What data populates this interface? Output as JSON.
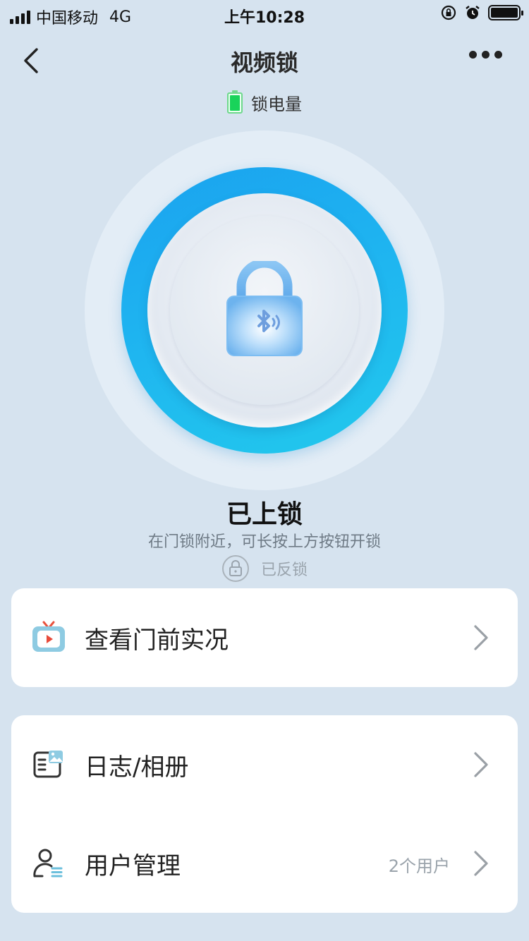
{
  "status_bar": {
    "carrier": "中国移动",
    "network": "4G",
    "time": "上午10:28"
  },
  "nav": {
    "title": "视频锁",
    "back_icon": "chevron-left-icon",
    "more_icon": "more-dots-icon"
  },
  "battery": {
    "label": "锁电量",
    "level": 1.0,
    "color": "#19d35a"
  },
  "lock": {
    "status": "已上锁",
    "hint": "在门锁附近，可长按上方按钮开锁",
    "anti_lock_label": "已反锁",
    "ring_color": "#1fb6f0"
  },
  "menu": {
    "live_view": {
      "label": "查看门前实况",
      "icon": "tv-play-icon"
    },
    "logs": {
      "label": "日志/相册",
      "icon": "log-album-icon"
    },
    "users": {
      "label": "用户管理",
      "count": "2个用户",
      "icon": "user-manage-icon"
    }
  }
}
